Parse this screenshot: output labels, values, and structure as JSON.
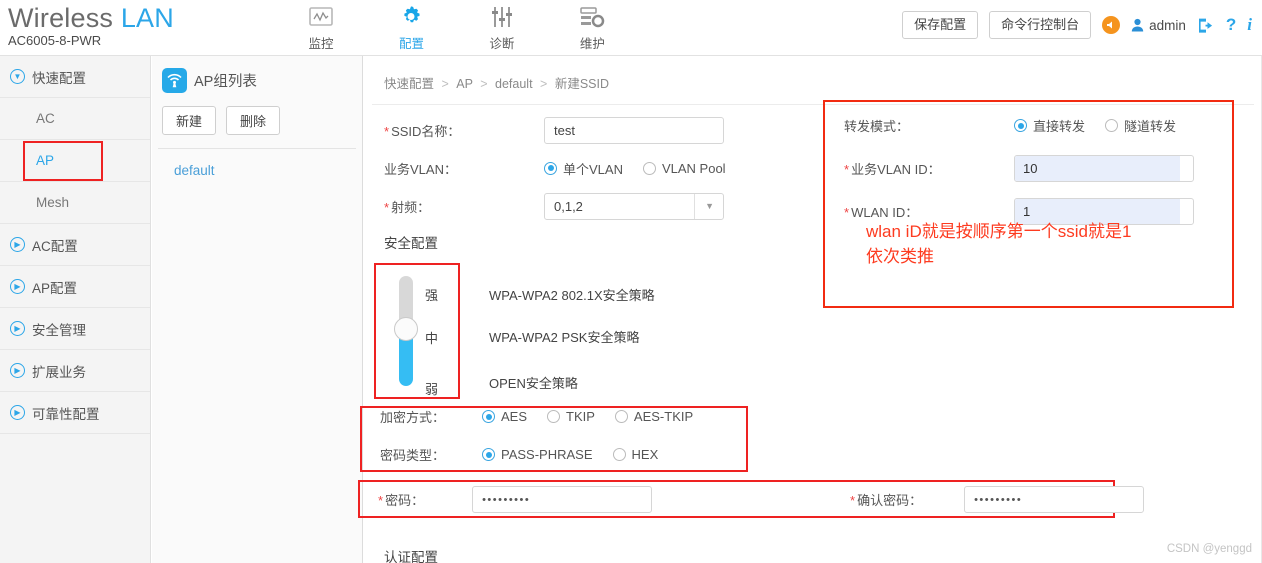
{
  "header": {
    "brand_main": "Wireless",
    "brand_accent": "LAN",
    "model": "AC6005-8-PWR",
    "nav": [
      {
        "label": "监控",
        "icon": "monitor-icon",
        "active": false
      },
      {
        "label": "配置",
        "icon": "gear-icon",
        "active": true
      },
      {
        "label": "诊断",
        "icon": "sliders-icon",
        "active": false
      },
      {
        "label": "维护",
        "icon": "maintenance-icon",
        "active": false
      }
    ],
    "save_button": "保存配置",
    "cli_button": "命令行控制台",
    "user": "admin",
    "icons": {
      "alert": "alert-bell-icon",
      "user": "user-icon",
      "logout": "logout-icon",
      "help": "?",
      "info": "i"
    }
  },
  "sidebar": {
    "items": [
      {
        "label": "快速配置",
        "type": "group",
        "expanded": true
      },
      {
        "label": "AC",
        "type": "sub",
        "active": false
      },
      {
        "label": "AP",
        "type": "sub",
        "active": true,
        "highlighted": true
      },
      {
        "label": "Mesh",
        "type": "sub",
        "active": false
      },
      {
        "label": "AC配置",
        "type": "group",
        "expanded": false
      },
      {
        "label": "AP配置",
        "type": "group",
        "expanded": false
      },
      {
        "label": "安全管理",
        "type": "group",
        "expanded": false
      },
      {
        "label": "扩展业务",
        "type": "group",
        "expanded": false
      },
      {
        "label": "可靠性配置",
        "type": "group",
        "expanded": false
      }
    ]
  },
  "ap_panel": {
    "title": "AP组列表",
    "new_button": "新建",
    "delete_button": "删除",
    "groups": [
      "default"
    ]
  },
  "breadcrumb": {
    "item1": "快速配置",
    "item2": "AP",
    "item3": "default",
    "item4": "新建SSID"
  },
  "form_left": {
    "ssid_label": "SSID名称：",
    "ssid_value": "test",
    "vlan_label": "业务VLAN：",
    "vlan_options": [
      "单个VLAN",
      "VLAN Pool"
    ],
    "vlan_selected": "单个VLAN",
    "radio_label": "射频：",
    "radio_value": "0,1,2"
  },
  "form_right": {
    "forward_label": "转发模式：",
    "forward_options": [
      "直接转发",
      "隧道转发"
    ],
    "forward_selected": "直接转发",
    "vlan_id_label": "业务VLAN ID：",
    "vlan_id_value": "10",
    "wlan_id_label": "WLAN ID：",
    "wlan_id_value": "1"
  },
  "annotation": {
    "line1": "wlan iD就是按顺序第一个ssid就是1",
    "line2": "依次类推",
    "color": "#fd3b20"
  },
  "security": {
    "section_title": "安全配置",
    "levels": [
      "强",
      "中",
      "弱"
    ],
    "selected_level": "中",
    "policies": [
      "WPA-WPA2 802.1X安全策略",
      "WPA-WPA2 PSK安全策略",
      "OPEN安全策略"
    ]
  },
  "encryption": {
    "method_label": "加密方式：",
    "method_options": [
      "AES",
      "TKIP",
      "AES-TKIP"
    ],
    "method_selected": "AES",
    "pwdtype_label": "密码类型：",
    "pwdtype_options": [
      "PASS-PHRASE",
      "HEX"
    ],
    "pwdtype_selected": "PASS-PHRASE"
  },
  "password": {
    "label": "密码：",
    "value": "•••••••••",
    "confirm_label": "确认密码：",
    "confirm_value": "•••••••••"
  },
  "auth": {
    "section_title": "认证配置"
  },
  "watermark": "CSDN @yenggd",
  "colors": {
    "accent": "#2ca6e8",
    "annotation_red": "#fd3b20",
    "box_red": "#ee2222",
    "autofill": "#e8eefb"
  }
}
